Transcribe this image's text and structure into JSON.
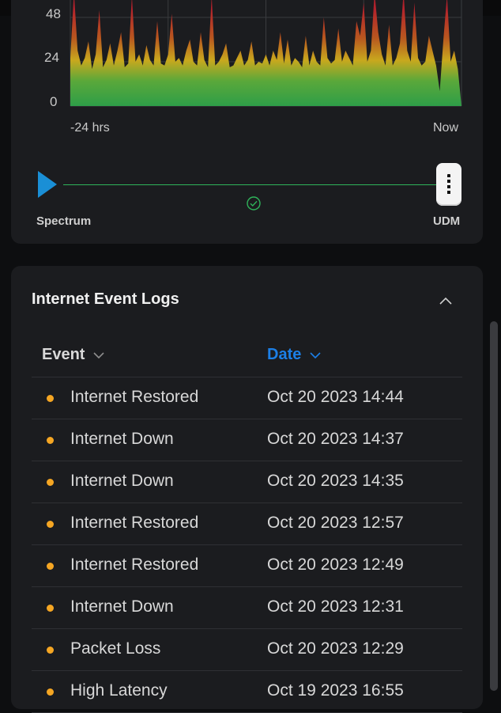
{
  "chart": {
    "y_ticks": [
      "48",
      "24",
      "0"
    ],
    "x_ticks": [
      "-24 hrs",
      "Now"
    ]
  },
  "chart_data": {
    "type": "area",
    "ylim": [
      0,
      48
    ],
    "x_range_labels": [
      "-24 hrs",
      "Now"
    ],
    "grid": true,
    "values": [
      26,
      64,
      30,
      22,
      26,
      35,
      20,
      28,
      52,
      21,
      25,
      34,
      22,
      30,
      40,
      21,
      23,
      60,
      24,
      28,
      22,
      33,
      25,
      22,
      46,
      23,
      22,
      28,
      50,
      24,
      26,
      22,
      30,
      36,
      24,
      22,
      40,
      25,
      21,
      60,
      22,
      24,
      28,
      34,
      21,
      22,
      26,
      30,
      22,
      25,
      35,
      22,
      24,
      23,
      28,
      22,
      30,
      25,
      40,
      23,
      36,
      22,
      26,
      24,
      21,
      38,
      22,
      30,
      24,
      22,
      48,
      26,
      23,
      25,
      42,
      24,
      30,
      26,
      22,
      46,
      38,
      56,
      24,
      30,
      62,
      40,
      28,
      22,
      44,
      22,
      26,
      34,
      68,
      30,
      24,
      56,
      26,
      22,
      24,
      38,
      30,
      22,
      8,
      36,
      60,
      24,
      30,
      20,
      0
    ]
  },
  "topology": {
    "left_label": "Spectrum",
    "right_label": "UDM",
    "status": "connected"
  },
  "logs": {
    "title": "Internet Event Logs",
    "col_event": "Event",
    "col_date": "Date",
    "rows": [
      {
        "event": "Internet Restored",
        "date": "Oct 20 2023 14:44"
      },
      {
        "event": "Internet Down",
        "date": "Oct 20 2023 14:37"
      },
      {
        "event": "Internet Down",
        "date": "Oct 20 2023 14:35"
      },
      {
        "event": "Internet Restored",
        "date": "Oct 20 2023 12:57"
      },
      {
        "event": "Internet Restored",
        "date": "Oct 20 2023 12:49"
      },
      {
        "event": "Internet Down",
        "date": "Oct 20 2023 12:31"
      },
      {
        "event": "Packet Loss",
        "date": "Oct 20 2023 12:29"
      },
      {
        "event": "High Latency",
        "date": "Oct 19 2023 16:55"
      }
    ]
  },
  "colors": {
    "accent": "#1c7fe6",
    "status_dot": "#f5a623",
    "link_ok": "#2fb35a",
    "chart_low": "#2e9e48",
    "chart_mid": "#c8a81e",
    "chart_high": "#b4232c"
  },
  "icons": {
    "spectrum": "play-triangle-icon",
    "check": "check-circle-icon",
    "udm": "udm-device-icon",
    "collapse": "chevron-up-icon",
    "sort": "chevron-down-icon"
  }
}
